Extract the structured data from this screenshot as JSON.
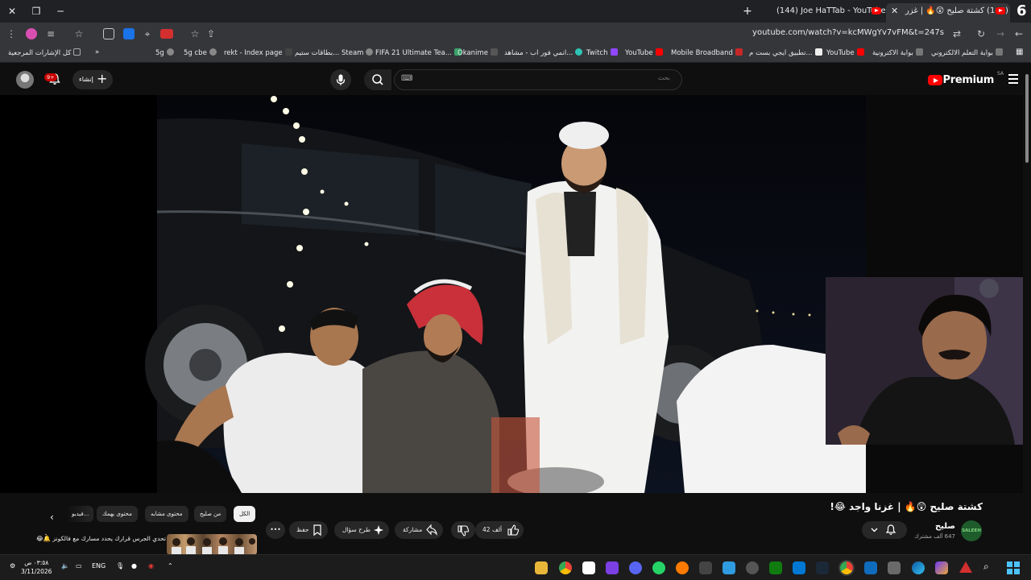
{
  "browser": {
    "tabs": [
      {
        "title": "(144) كشتة صليح 😲🔥 | غزر"
      },
      {
        "title": "(144) Joe HaTTab - YouTube"
      }
    ],
    "badge": "6",
    "url": "youtube.com/watch?v=kcMWgYv7vFM&t=247s"
  },
  "bookmarks": [
    {
      "label": "كل الإشارات المرجعية"
    },
    {
      "label": "5g"
    },
    {
      "label": "5g cbe"
    },
    {
      "label": "rekt - Index page"
    },
    {
      "label": "بطاقات ستيم... Steam"
    },
    {
      "label": "FIFA 21 Ultimate Tea..."
    },
    {
      "label": "Okanime"
    },
    {
      "label": "انمي فور اب - مشاهد..."
    },
    {
      "label": "Twitch"
    },
    {
      "label": "YouTube"
    },
    {
      "label": "Mobile Broadband"
    },
    {
      "label": "تطبيق ايجي بست م..."
    },
    {
      "label": "YouTube"
    },
    {
      "label": "بوابة الاكترونية"
    },
    {
      "label": "بوابة التعلم الالكتروني"
    }
  ],
  "header": {
    "logo_text": "Premium",
    "region": "SA",
    "search_placeholder": "بحث",
    "create_label": "إنشاء",
    "notification_count": "9+"
  },
  "video": {
    "title": "كشتة صليح 😲🔥 | غزنا واجد 😂!",
    "channel": "صليح",
    "subscribers": "647 ألف مشترك",
    "likes": "42 ألف",
    "share_label": "مشاركة",
    "ask_label": "طرح سؤال",
    "save_label": "حفظ",
    "more_label": "•••"
  },
  "chips": [
    {
      "label": "الكل",
      "active": true
    },
    {
      "label": "من صليح"
    },
    {
      "label": "محتوى مشابه"
    },
    {
      "label": "محتوى يهمك"
    },
    {
      "label": "فيديو..."
    }
  ],
  "recommendation": {
    "title": "تحدي الجرس قرارك يحدد مسارك مع فالكونز 🔔😂"
  },
  "taskbar": {
    "time": "٠٣:٥٨ ص",
    "date": "3/11/2026",
    "lang": "ENG"
  },
  "colors": {
    "youtube_red": "#ff0000",
    "background": "#0f0f0f",
    "chip_bg": "#272727"
  }
}
